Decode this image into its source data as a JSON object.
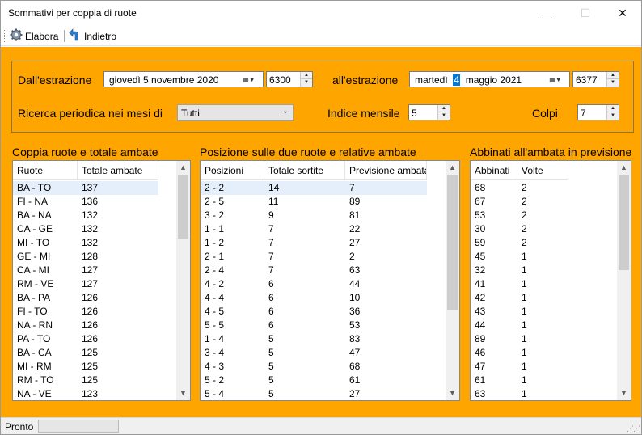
{
  "window": {
    "title": "Sommativi per coppia di ruote",
    "min_glyph": "—",
    "max_glyph": "☐",
    "close_glyph": "✕"
  },
  "toolbar": {
    "elabora_label": "Elabora",
    "elabora_icon": "gear-icon",
    "indietro_label": "Indietro",
    "indietro_icon": "back-arrow-icon"
  },
  "params": {
    "from_label": "Dall'estrazione",
    "from_date_pre": "giovedì   5 novembre 2020",
    "from_number": "6300",
    "to_label": "all'estrazione",
    "to_date_weekday": "martedì",
    "to_date_day": "4",
    "to_date_rest": "maggio   2021",
    "to_number": "6377",
    "periodic_label": "Ricerca periodica nei mesi di",
    "periodic_value": "Tutti",
    "index_label": "Indice mensile",
    "index_value": "5",
    "colpi_label": "Colpi",
    "colpi_value": "7"
  },
  "sections": {
    "coppia_title": "Coppia ruote e totale ambate",
    "posizione_title": "Posizione sulle due ruote e relative ambate",
    "abbinati_title": "Abbinati all'ambata in previsione"
  },
  "coppia": {
    "headers": [
      "Ruote",
      "Totale ambate"
    ],
    "rows": [
      [
        "BA - TO",
        "137"
      ],
      [
        "FI - NA",
        "136"
      ],
      [
        "BA - NA",
        "132"
      ],
      [
        "CA - GE",
        "132"
      ],
      [
        "MI - TO",
        "132"
      ],
      [
        "GE - MI",
        "128"
      ],
      [
        "CA - MI",
        "127"
      ],
      [
        "RM - VE",
        "127"
      ],
      [
        "BA - PA",
        "126"
      ],
      [
        "FI - TO",
        "126"
      ],
      [
        "NA - RN",
        "126"
      ],
      [
        "PA - TO",
        "126"
      ],
      [
        "BA - CA",
        "125"
      ],
      [
        "MI - RM",
        "125"
      ],
      [
        "RM - TO",
        "125"
      ],
      [
        "NA - VE",
        "123"
      ]
    ],
    "scroll_position": 0.0,
    "visible_fraction": 0.3
  },
  "posizione": {
    "headers": [
      "Posizioni",
      "Totale sortite",
      "Previsione ambata"
    ],
    "rows": [
      [
        "2 - 2",
        "14",
        "7"
      ],
      [
        "2 - 5",
        "11",
        "89"
      ],
      [
        "3 - 2",
        "9",
        "81"
      ],
      [
        "1 - 1",
        "7",
        "22"
      ],
      [
        "1 - 2",
        "7",
        "27"
      ],
      [
        "2 - 1",
        "7",
        "2"
      ],
      [
        "2 - 4",
        "7",
        "63"
      ],
      [
        "4 - 2",
        "6",
        "44"
      ],
      [
        "4 - 4",
        "6",
        "10"
      ],
      [
        "4 - 5",
        "6",
        "36"
      ],
      [
        "5 - 5",
        "6",
        "53"
      ],
      [
        "1 - 4",
        "5",
        "83"
      ],
      [
        "3 - 4",
        "5",
        "47"
      ],
      [
        "4 - 3",
        "5",
        "68"
      ],
      [
        "5 - 2",
        "5",
        "61"
      ],
      [
        "5 - 4",
        "5",
        "27"
      ]
    ],
    "scroll_position": 0.0,
    "visible_fraction": 0.64
  },
  "abbinati": {
    "headers": [
      "Abbinati",
      "Volte"
    ],
    "rows": [
      [
        "68",
        "2"
      ],
      [
        "67",
        "2"
      ],
      [
        "53",
        "2"
      ],
      [
        "30",
        "2"
      ],
      [
        "59",
        "2"
      ],
      [
        "45",
        "1"
      ],
      [
        "32",
        "1"
      ],
      [
        "41",
        "1"
      ],
      [
        "42",
        "1"
      ],
      [
        "43",
        "1"
      ],
      [
        "44",
        "1"
      ],
      [
        "89",
        "1"
      ],
      [
        "46",
        "1"
      ],
      [
        "47",
        "1"
      ],
      [
        "61",
        "1"
      ],
      [
        "63",
        "1"
      ]
    ],
    "scroll_position": 0.0,
    "visible_fraction": 0.45
  },
  "status": {
    "text": "Pronto",
    "progress": 0
  },
  "colors": {
    "background": "#ffa500",
    "selection": "#e5effb",
    "highlight": "#0078d7"
  }
}
